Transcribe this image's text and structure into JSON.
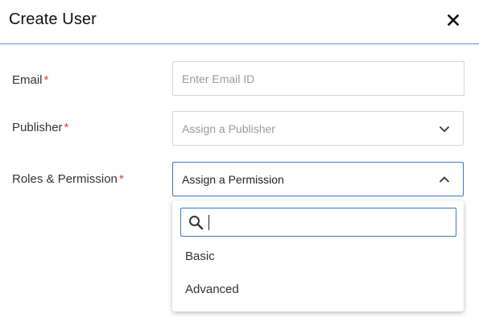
{
  "dialog": {
    "title": "Create User"
  },
  "form": {
    "email": {
      "label": "Email",
      "required_mark": "*",
      "placeholder": "Enter Email ID"
    },
    "publisher": {
      "label": "Publisher",
      "required_mark": "*",
      "placeholder": "Assign a Publisher"
    },
    "roles": {
      "label": "Roles & Permission",
      "required_mark": "*",
      "value": "Assign a Permission",
      "dropdown": {
        "search_value": "",
        "options": [
          "Basic",
          "Advanced"
        ]
      }
    }
  },
  "colors": {
    "accent": "#3b78c3",
    "required": "#e53935",
    "header_divider": "#4a90e2"
  }
}
